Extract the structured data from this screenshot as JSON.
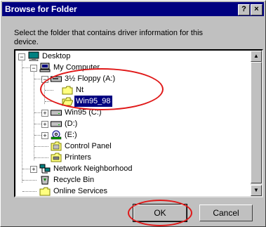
{
  "window": {
    "title": "Browse for Folder",
    "help_label": "?",
    "close_label": "×"
  },
  "instruction": "Select the folder that contains driver information for this device.",
  "tree": {
    "items": [
      {
        "label": "Desktop",
        "icon": "desktop-icon"
      },
      {
        "label": "My Computer",
        "icon": "computer-icon"
      },
      {
        "label": "3½ Floppy (A:)",
        "icon": "floppy-drive-icon"
      },
      {
        "label": "Nt",
        "icon": "folder-icon"
      },
      {
        "label": "Win95_98",
        "icon": "folder-open-icon",
        "selected": true
      },
      {
        "label": "Win95 (C:)",
        "icon": "hard-drive-icon"
      },
      {
        "label": "(D:)",
        "icon": "hard-drive-icon"
      },
      {
        "label": "(E:)",
        "icon": "cdrom-drive-icon"
      },
      {
        "label": "Control Panel",
        "icon": "control-panel-icon"
      },
      {
        "label": "Printers",
        "icon": "printers-icon"
      },
      {
        "label": "Network Neighborhood",
        "icon": "network-icon"
      },
      {
        "label": "Recycle Bin",
        "icon": "recycle-bin-icon"
      },
      {
        "label": "Online Services",
        "icon": "folder-icon"
      }
    ]
  },
  "buttons": {
    "ok": "OK",
    "cancel": "Cancel"
  },
  "colors": {
    "titlebar": "#000080",
    "selection": "#000080",
    "annotation": "#e01818"
  }
}
